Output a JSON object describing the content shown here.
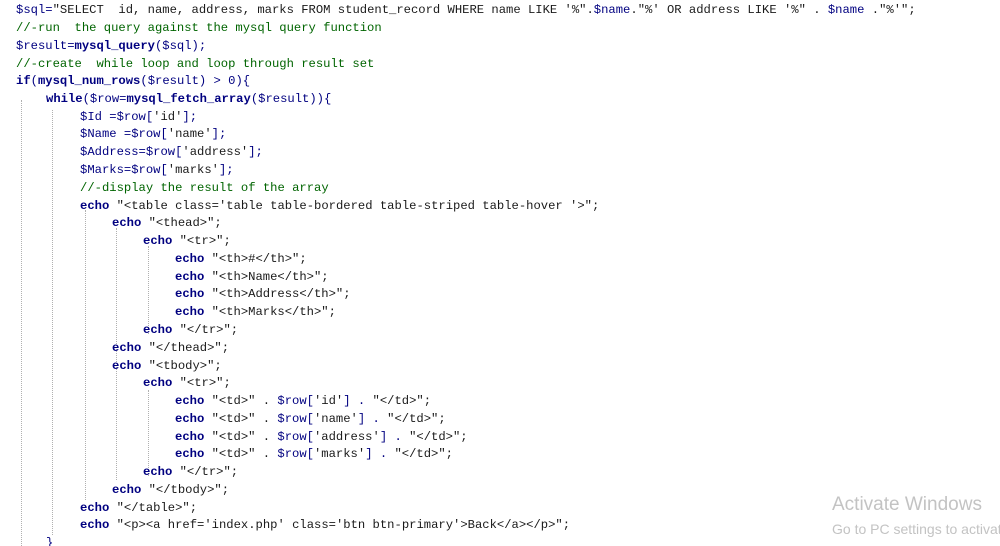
{
  "code_lines": [
    [
      {
        "t": "$sql=",
        "c": "var"
      },
      {
        "t": "\"SELECT  id, name, address, marks FROM student_record WHERE name LIKE '%\".",
        "c": "str"
      },
      {
        "t": "$name",
        "c": "var"
      },
      {
        "t": ".\"%' OR address LIKE '%\" . ",
        "c": "str"
      },
      {
        "t": "$name",
        "c": "var"
      },
      {
        "t": " .\"%'\";",
        "c": "str"
      }
    ],
    [
      {
        "t": "//-run  the query against the mysql query function",
        "c": "cmt"
      }
    ],
    [
      {
        "t": "$result=",
        "c": "var"
      },
      {
        "t": "mysql_query",
        "c": "fn"
      },
      {
        "t": "($sql);",
        "c": "var"
      }
    ],
    [
      {
        "t": "//-create  while loop and loop through result set",
        "c": "cmt"
      }
    ],
    [
      {
        "t": "if",
        "c": "kw"
      },
      {
        "t": "(",
        "c": "var"
      },
      {
        "t": "mysql_num_rows",
        "c": "fn"
      },
      {
        "t": "($result) > 0){",
        "c": "var"
      }
    ],
    [
      {
        "t": "while",
        "c": "kw"
      },
      {
        "t": "($row=",
        "c": "var"
      },
      {
        "t": "mysql_fetch_array",
        "c": "fn"
      },
      {
        "t": "($result)){",
        "c": "var"
      }
    ],
    [
      {
        "t": "$Id =$row[",
        "c": "var"
      },
      {
        "t": "'id'",
        "c": "str"
      },
      {
        "t": "];",
        "c": "var"
      }
    ],
    [
      {
        "t": "$Name =$row[",
        "c": "var"
      },
      {
        "t": "'name'",
        "c": "str"
      },
      {
        "t": "];",
        "c": "var"
      }
    ],
    [
      {
        "t": "$Address=$row[",
        "c": "var"
      },
      {
        "t": "'address'",
        "c": "str"
      },
      {
        "t": "];",
        "c": "var"
      }
    ],
    [
      {
        "t": "$Marks=$row[",
        "c": "var"
      },
      {
        "t": "'marks'",
        "c": "str"
      },
      {
        "t": "];",
        "c": "var"
      }
    ],
    [
      {
        "t": "//-display the result of the array",
        "c": "cmt"
      }
    ],
    [
      {
        "t": "echo",
        "c": "kw"
      },
      {
        "t": " \"<table class='table table-bordered table-striped table-hover '>\";",
        "c": "str"
      }
    ],
    [
      {
        "t": "echo",
        "c": "kw"
      },
      {
        "t": " \"<thead>\";",
        "c": "str"
      }
    ],
    [
      {
        "t": "echo",
        "c": "kw"
      },
      {
        "t": " \"<tr>\";",
        "c": "str"
      }
    ],
    [
      {
        "t": "echo",
        "c": "kw"
      },
      {
        "t": " \"<th>#</th>\";",
        "c": "str"
      }
    ],
    [
      {
        "t": "echo",
        "c": "kw"
      },
      {
        "t": " \"<th>Name</th>\";",
        "c": "str"
      }
    ],
    [
      {
        "t": "echo",
        "c": "kw"
      },
      {
        "t": " \"<th>Address</th>\";",
        "c": "str"
      }
    ],
    [
      {
        "t": "echo",
        "c": "kw"
      },
      {
        "t": " \"<th>Marks</th>\";",
        "c": "str"
      }
    ],
    [
      {
        "t": "echo",
        "c": "kw"
      },
      {
        "t": " \"</tr>\";",
        "c": "str"
      }
    ],
    [
      {
        "t": "echo",
        "c": "kw"
      },
      {
        "t": " \"</thead>\";",
        "c": "str"
      }
    ],
    [
      {
        "t": "echo",
        "c": "kw"
      },
      {
        "t": " \"<tbody>\";",
        "c": "str"
      }
    ],
    [
      {
        "t": "echo",
        "c": "kw"
      },
      {
        "t": " \"<tr>\";",
        "c": "str"
      }
    ],
    [
      {
        "t": "echo",
        "c": "kw"
      },
      {
        "t": " \"<td>\" . ",
        "c": "str"
      },
      {
        "t": "$row[",
        "c": "var"
      },
      {
        "t": "'id'",
        "c": "str"
      },
      {
        "t": "] . ",
        "c": "var"
      },
      {
        "t": "\"</td>\";",
        "c": "str"
      }
    ],
    [
      {
        "t": "echo",
        "c": "kw"
      },
      {
        "t": " \"<td>\" . ",
        "c": "str"
      },
      {
        "t": "$row[",
        "c": "var"
      },
      {
        "t": "'name'",
        "c": "str"
      },
      {
        "t": "] . ",
        "c": "var"
      },
      {
        "t": "\"</td>\";",
        "c": "str"
      }
    ],
    [
      {
        "t": "echo",
        "c": "kw"
      },
      {
        "t": " \"<td>\" . ",
        "c": "str"
      },
      {
        "t": "$row[",
        "c": "var"
      },
      {
        "t": "'address'",
        "c": "str"
      },
      {
        "t": "] . ",
        "c": "var"
      },
      {
        "t": "\"</td>\";",
        "c": "str"
      }
    ],
    [
      {
        "t": "echo",
        "c": "kw"
      },
      {
        "t": " \"<td>\" . ",
        "c": "str"
      },
      {
        "t": "$row[",
        "c": "var"
      },
      {
        "t": "'marks'",
        "c": "str"
      },
      {
        "t": "] . ",
        "c": "var"
      },
      {
        "t": "\"</td>\";",
        "c": "str"
      }
    ],
    [
      {
        "t": "echo",
        "c": "kw"
      },
      {
        "t": " \"</tr>\";",
        "c": "str"
      }
    ],
    [
      {
        "t": "echo",
        "c": "kw"
      },
      {
        "t": " \"</tbody>\";",
        "c": "str"
      }
    ],
    [
      {
        "t": "echo",
        "c": "kw"
      },
      {
        "t": " \"</table>\";",
        "c": "str"
      }
    ],
    [
      {
        "t": "echo",
        "c": "kw"
      },
      {
        "t": " \"<p><a href='index.php' class='btn btn-primary'>Back</a></p>\";",
        "c": "str"
      }
    ],
    [
      {
        "t": "}",
        "c": "var"
      }
    ]
  ],
  "watermark": {
    "title": "Activate Windows",
    "subtitle": "Go to PC settings to activate"
  }
}
